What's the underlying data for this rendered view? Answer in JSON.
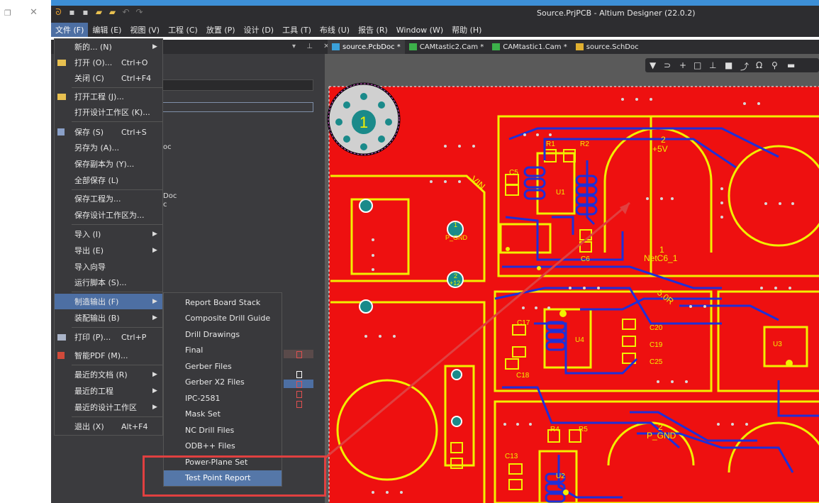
{
  "window": {
    "title": "Source.PrjPCB - Altium Designer (22.0.2)"
  },
  "menubar": [
    {
      "label": "文件 (F)",
      "active": true
    },
    {
      "label": "编辑 (E)"
    },
    {
      "label": "视图 (V)"
    },
    {
      "label": "工程 (C)"
    },
    {
      "label": "放置 (P)"
    },
    {
      "label": "设计 (D)"
    },
    {
      "label": "工具 (T)"
    },
    {
      "label": "布线 (U)"
    },
    {
      "label": "报告 (R)"
    },
    {
      "label": "Window (W)"
    },
    {
      "label": "帮助 (H)"
    }
  ],
  "tabs": [
    {
      "label": "source.PcbDoc *",
      "icon": "pcb-doc-icon",
      "color": "#3aa0d8",
      "active": true
    },
    {
      "label": "CAMtastic2.Cam *",
      "icon": "cam-doc-icon",
      "color": "#3cb04a"
    },
    {
      "label": "CAMtastic1.Cam *",
      "icon": "cam-doc-icon",
      "color": "#3cb04a"
    },
    {
      "label": "source.SchDoc",
      "icon": "sch-doc-icon",
      "color": "#e0b030"
    }
  ],
  "file_menu": [
    {
      "label": "新的... (N)",
      "shortcut": "",
      "submenu": true
    },
    {
      "label": "打开 (O)...",
      "shortcut": "Ctrl+O",
      "icon": "folder-open-icon"
    },
    {
      "label": "关闭 (C)",
      "shortcut": "Ctrl+F4"
    },
    {
      "label": "打开工程 (J)...",
      "shortcut": "",
      "icon": "open-project-icon"
    },
    {
      "label": "打开设计工作区 (K)...",
      "shortcut": ""
    },
    {
      "label": "保存 (S)",
      "shortcut": "Ctrl+S",
      "icon": "save-icon"
    },
    {
      "label": "另存为 (A)...",
      "shortcut": ""
    },
    {
      "label": "保存副本为 (Y)...",
      "shortcut": ""
    },
    {
      "label": "全部保存 (L)",
      "shortcut": ""
    },
    {
      "label": "保存工程为...",
      "shortcut": ""
    },
    {
      "label": "保存设计工作区为...",
      "shortcut": ""
    },
    {
      "label": "导入 (I)",
      "shortcut": "",
      "submenu": true
    },
    {
      "label": "导出 (E)",
      "shortcut": "",
      "submenu": true
    },
    {
      "label": "导入向导",
      "shortcut": ""
    },
    {
      "label": "运行脚本 (S)...",
      "shortcut": ""
    },
    {
      "label": "制造输出 (F)",
      "shortcut": "",
      "submenu": true,
      "highlighted": true
    },
    {
      "label": "装配输出 (B)",
      "shortcut": "",
      "submenu": true
    },
    {
      "label": "打印 (P)...",
      "shortcut": "Ctrl+P",
      "icon": "print-icon"
    },
    {
      "label": "智能PDF (M)...",
      "shortcut": "",
      "icon": "pdf-icon"
    },
    {
      "label": "最近的文档 (R)",
      "shortcut": "",
      "submenu": true
    },
    {
      "label": "最近的工程",
      "shortcut": "",
      "submenu": true
    },
    {
      "label": "最近的设计工作区",
      "shortcut": "",
      "submenu": true
    },
    {
      "label": "退出 (X)",
      "shortcut": "Alt+F4"
    }
  ],
  "fabrication_submenu": [
    {
      "label": "Report Board Stack"
    },
    {
      "label": "Composite Drill Guide"
    },
    {
      "label": "Drill Drawings"
    },
    {
      "label": "Final"
    },
    {
      "label": "Gerber Files"
    },
    {
      "label": "Gerber X2 Files"
    },
    {
      "label": "IPC-2581"
    },
    {
      "label": "Mask Set"
    },
    {
      "label": "NC Drill Files"
    },
    {
      "label": "ODB++ Files"
    },
    {
      "label": "Power-Plane Set"
    },
    {
      "label": "Test Point Report",
      "highlighted": true
    }
  ],
  "panel_fragments": {
    "frag1": "oc",
    "frag2": "Doc",
    "frag3": "c"
  },
  "pcb_labels": {
    "hole1": "1",
    "r1": "R1",
    "r2": "R2",
    "c5": "C5",
    "u1": "U1",
    "c6": "C6",
    "vin": "VIN",
    "net_5v_num": "2",
    "net_5v": "+5V",
    "netc6_num": "1",
    "netc6": "NetC6_1",
    "gnd_pad_num": "1",
    "gnd_pad": "P_GND",
    "p12_num": "2",
    "p12": "+12",
    "fiveor": "5.0R",
    "c17": "C17",
    "u4": "U4",
    "c20": "C20",
    "c19": "C19",
    "c25": "C25",
    "c18": "C18",
    "u3": "U3",
    "r4": "R4",
    "r5": "R5",
    "pgnd_num": "2",
    "pgnd": "P_GND",
    "c13": "C13",
    "u2": "U2"
  },
  "colors": {
    "board": "#ee1010",
    "trace_yellow": "#f2f000",
    "trace_blue": "#1f2fd8",
    "pad_teal": "#1a8a8a",
    "menu_bg": "#39393c",
    "highlight": "#4d6fa3",
    "annotation": "#e04040"
  }
}
